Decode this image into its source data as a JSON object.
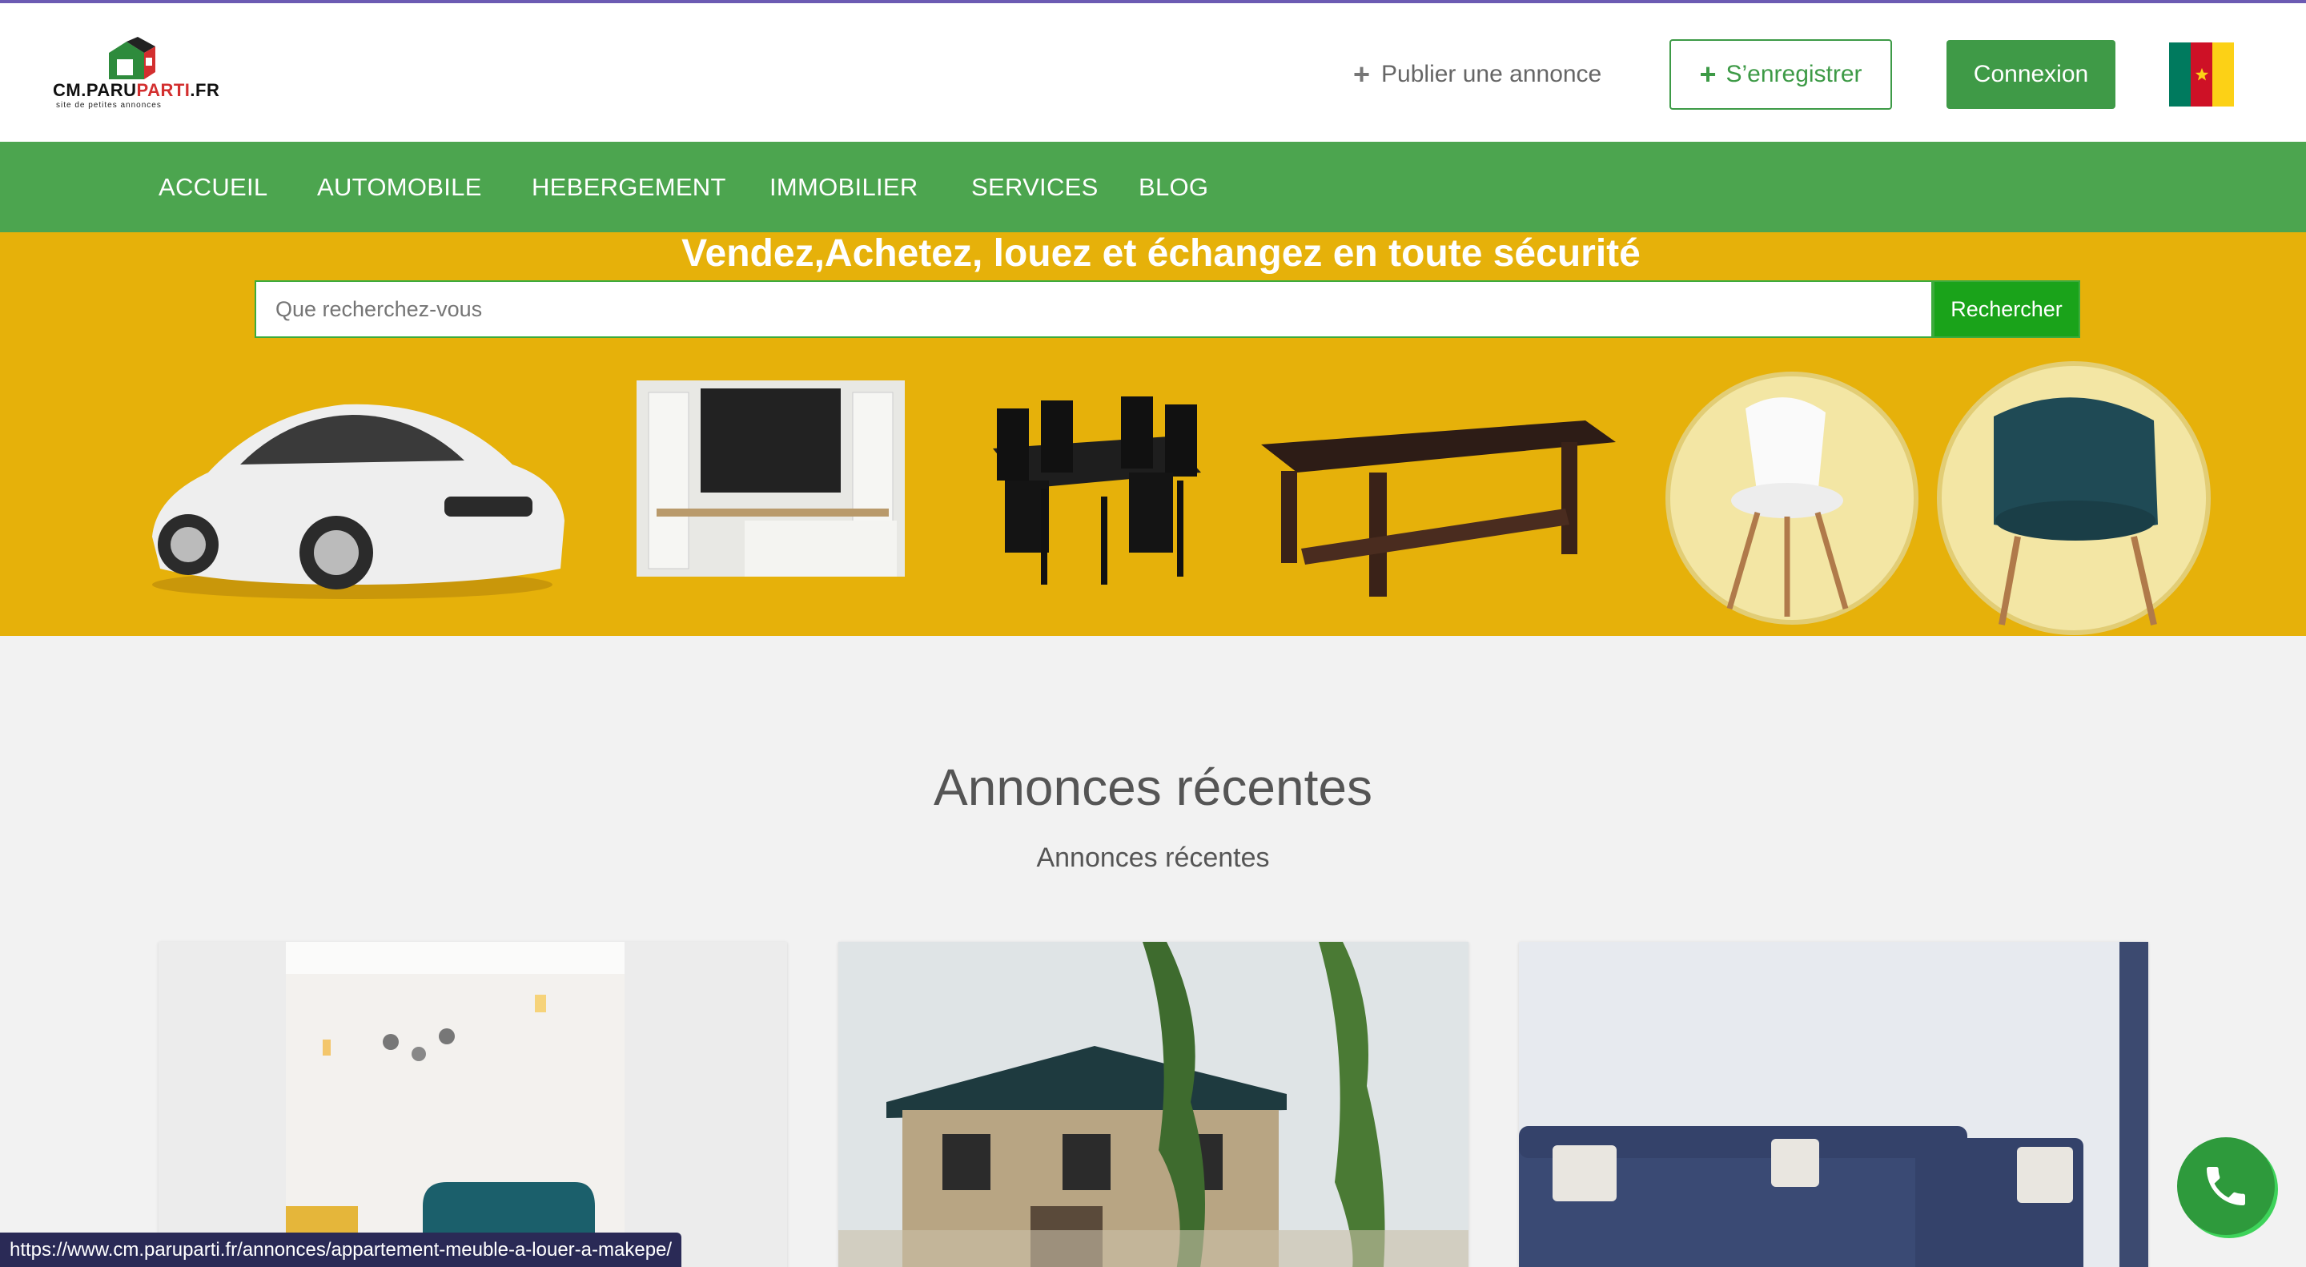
{
  "header": {
    "logo_text_a": "CM.PARU",
    "logo_text_b": "PARTI",
    "logo_text_c": ".FR",
    "logo_sub": "site de petites annonces",
    "publish_label": "Publier une annonce",
    "register_label": "S’enregistrer",
    "login_label": "Connexion",
    "flag_colors": [
      "#007a5e",
      "#ce1126",
      "#fcd116"
    ]
  },
  "nav": {
    "items": [
      "ACCUEIL",
      "AUTOMOBILE",
      "HEBERGEMENT",
      "IMMOBILIER",
      "SERVICES",
      "BLOG"
    ]
  },
  "hero": {
    "title": "Vendez,Achetez, louez et échangez en toute sécurité",
    "search_placeholder": "Que recherchez-vous",
    "search_button": "Rechercher"
  },
  "main": {
    "section_title": "Annonces récentes",
    "section_subtitle": "Annonces récentes"
  },
  "status_url": "https://www.cm.paruparti.fr/annonces/appartement-meuble-a-louer-a-makepe/",
  "colors": {
    "green": "#4ca54f",
    "yellow": "#e6b10a",
    "purple": "#6c5bb3"
  }
}
